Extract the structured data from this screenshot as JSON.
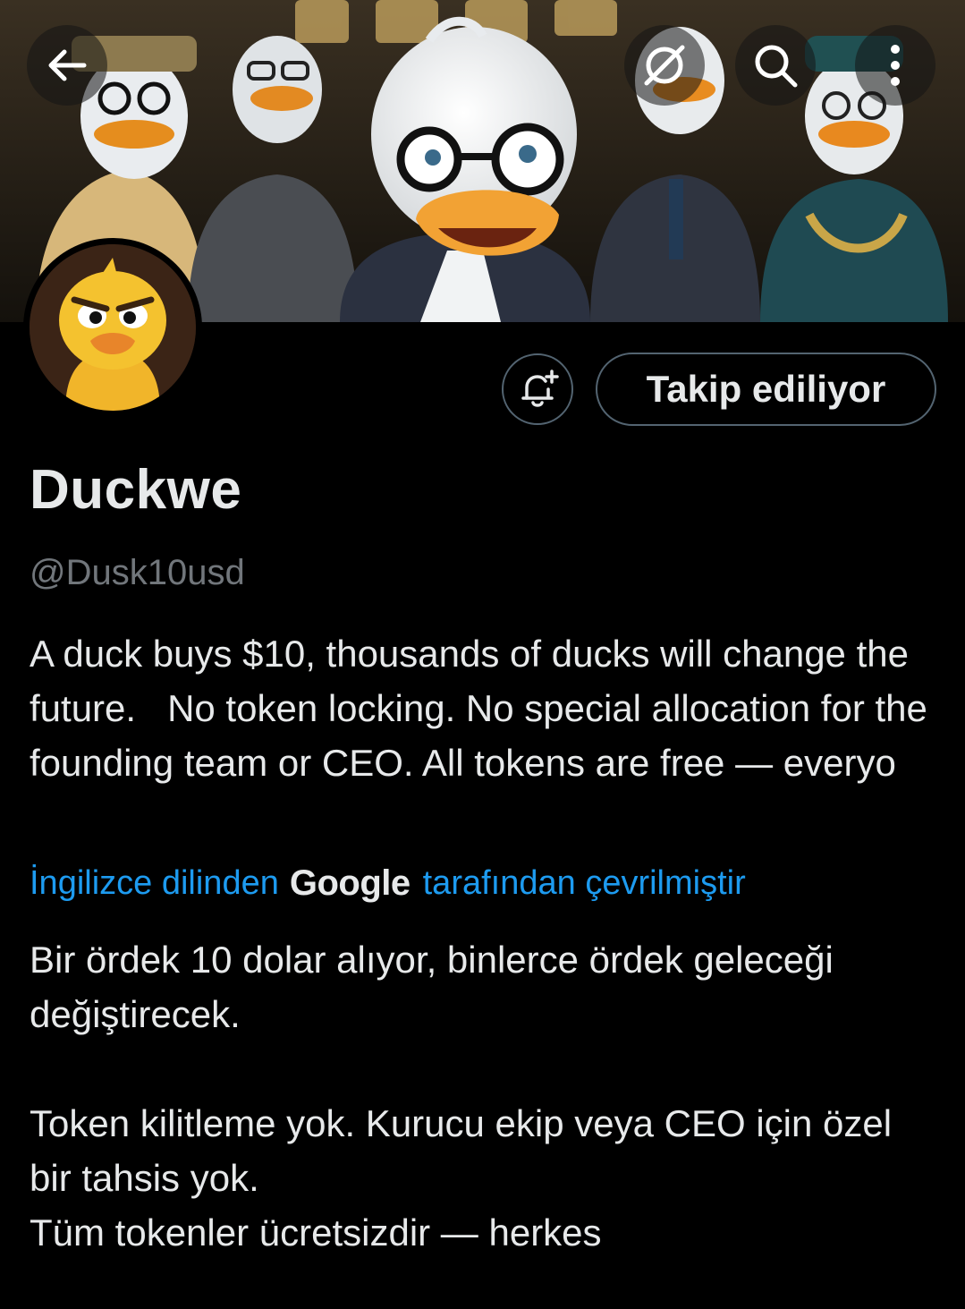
{
  "header": {
    "back_icon": "arrow-left-icon",
    "grok_icon": "grok-icon",
    "search_icon": "search-icon",
    "more_icon": "more-vertical-icon"
  },
  "profile": {
    "display_name": "Duckwe",
    "handle": "@Dusk10usd",
    "follow_label": "Takip ediliyor",
    "bell_icon": "bell-plus-icon"
  },
  "bio": {
    "original": "A duck buys $10, thousands of ducks will change the future.   No token locking. No special allocation for the founding team or CEO. All tokens are free — everyo",
    "translation_prefix": "İngilizce dilinden",
    "translation_brand": "Google",
    "translation_suffix": "tarafından çevrilmiştir",
    "translated_p1": "Bir ördek 10 dolar alıyor, binlerce ördek geleceği değiştirecek.",
    "translated_p2": "Token kilitleme yok. Kurucu ekip veya CEO için özel bir tahsis yok.",
    "translated_p3": "Tüm tokenler ücretsizdir — herkes"
  },
  "colors": {
    "background": "#000000",
    "primary_text": "#e7e9ea",
    "secondary_text": "#71767b",
    "link": "#1d9bf0",
    "border": "#536471"
  }
}
